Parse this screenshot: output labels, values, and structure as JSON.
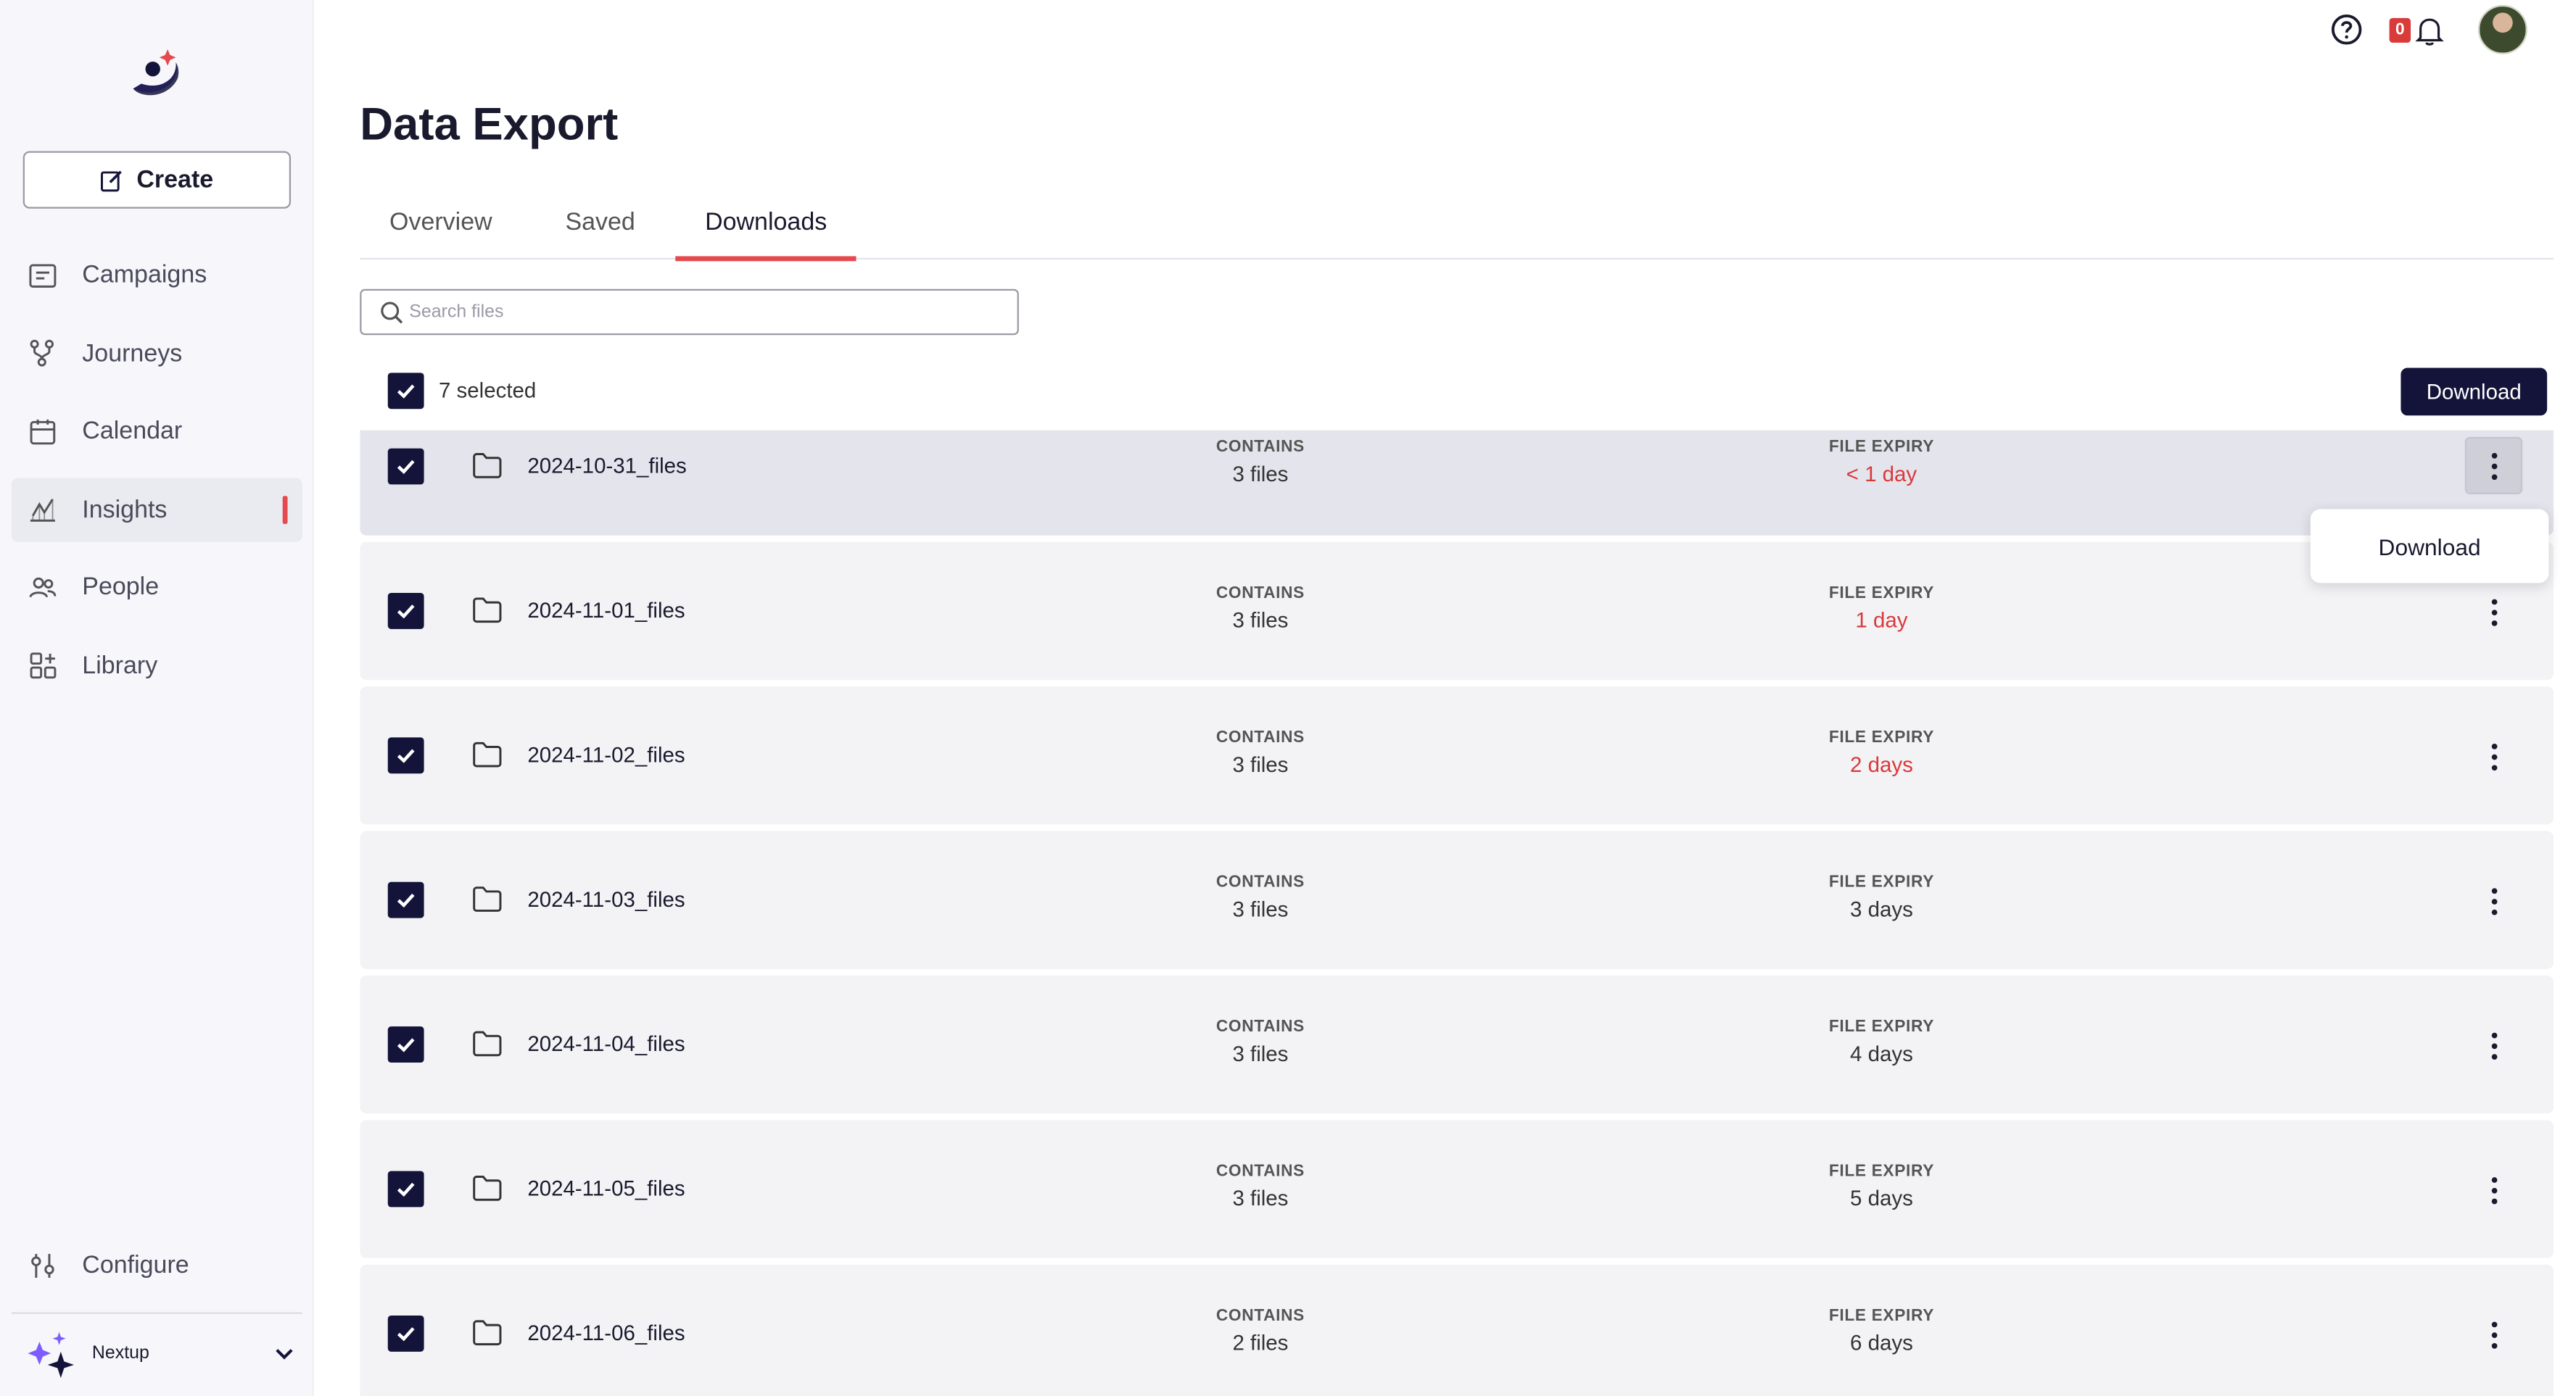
{
  "sidebar": {
    "create_label": "Create",
    "items": [
      {
        "label": "Campaigns",
        "icon": "campaigns-icon"
      },
      {
        "label": "Journeys",
        "icon": "journeys-icon"
      },
      {
        "label": "Calendar",
        "icon": "calendar-icon"
      },
      {
        "label": "Insights",
        "icon": "insights-icon",
        "active": true
      },
      {
        "label": "People",
        "icon": "people-icon"
      },
      {
        "label": "Library",
        "icon": "library-icon"
      }
    ],
    "configure_label": "Configure",
    "org_name": "Nextup"
  },
  "topbar": {
    "notification_count": "0"
  },
  "page": {
    "title": "Data Export",
    "tabs": [
      {
        "label": "Overview",
        "active": false
      },
      {
        "label": "Saved",
        "active": false
      },
      {
        "label": "Downloads",
        "active": true
      }
    ],
    "search_placeholder": "Search files",
    "selected_text": "7 selected",
    "download_label": "Download"
  },
  "files": {
    "contains_label": "CONTAINS",
    "expiry_label": "FILE EXPIRY",
    "rows": [
      {
        "name": "2024-10-31_files",
        "contains": "3 files",
        "expiry": "< 1 day",
        "expiry_warning": true,
        "checked": true
      },
      {
        "name": "2024-11-01_files",
        "contains": "3 files",
        "expiry": "1 day",
        "expiry_warning": true,
        "checked": true
      },
      {
        "name": "2024-11-02_files",
        "contains": "3 files",
        "expiry": "2 days",
        "expiry_warning": true,
        "checked": true
      },
      {
        "name": "2024-11-03_files",
        "contains": "3 files",
        "expiry": "3 days",
        "expiry_warning": false,
        "checked": true
      },
      {
        "name": "2024-11-04_files",
        "contains": "3 files",
        "expiry": "4 days",
        "expiry_warning": false,
        "checked": true
      },
      {
        "name": "2024-11-05_files",
        "contains": "3 files",
        "expiry": "5 days",
        "expiry_warning": false,
        "checked": true
      },
      {
        "name": "2024-11-06_files",
        "contains": "2 files",
        "expiry": "6 days",
        "expiry_warning": false,
        "checked": true
      }
    ]
  },
  "row_menu": {
    "download_label": "Download"
  },
  "colors": {
    "primary": "#14143a",
    "accent": "#e5484d",
    "warning": "#d93a3a"
  }
}
